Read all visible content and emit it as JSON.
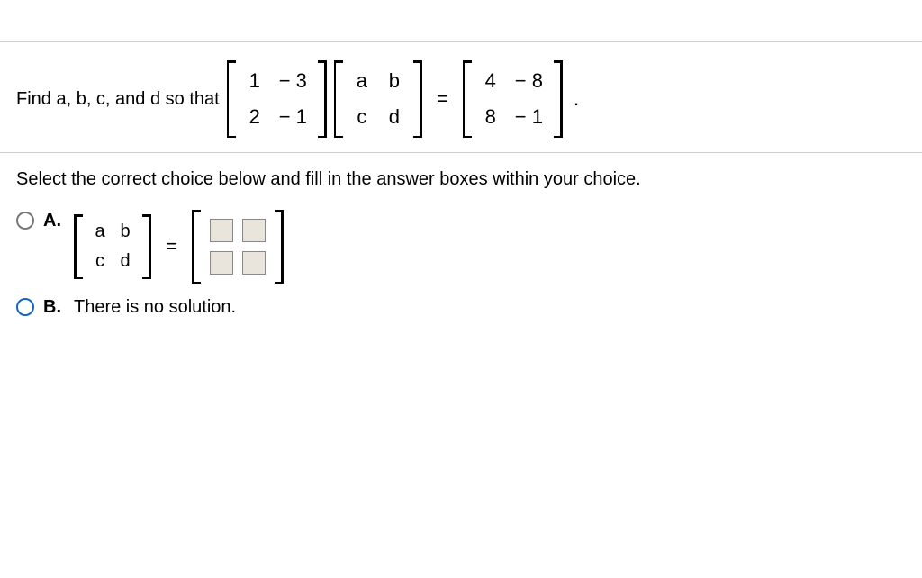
{
  "question": {
    "lead": "Find a, b, c, and d so that",
    "matrixL": {
      "r1c1": "1",
      "r1c2": "− 3",
      "r2c1": "2",
      "r2c2": "− 1"
    },
    "matrixM": {
      "r1c1": "a",
      "r1c2": "b",
      "r2c1": "c",
      "r2c2": "d"
    },
    "eq": "=",
    "matrixR": {
      "r1c1": "4",
      "r1c2": "− 8",
      "r2c1": "8",
      "r2c2": "− 1"
    },
    "terminator": "."
  },
  "instruction": "Select the correct choice below and fill in the answer boxes within your choice.",
  "choices": {
    "A": {
      "label": "A.",
      "lhsMatrix": {
        "r1c1": "a",
        "r1c2": "b",
        "r2c1": "c",
        "r2c2": "d"
      },
      "eq": "="
    },
    "B": {
      "label": "B.",
      "text": "There is no solution."
    }
  }
}
